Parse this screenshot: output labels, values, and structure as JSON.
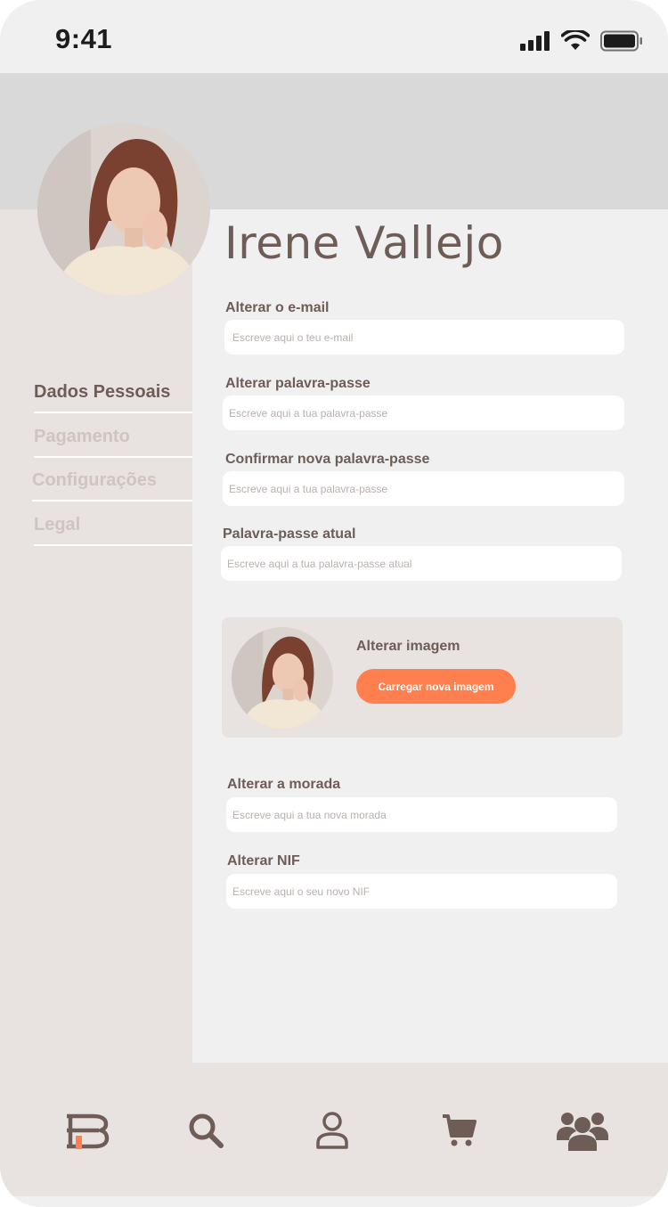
{
  "status_bar": {
    "time": "9:41"
  },
  "profile": {
    "name": "Irene Vallejo"
  },
  "sidebar": {
    "items": [
      {
        "label": "Dados Pessoais",
        "active": true
      },
      {
        "label": "Pagamento",
        "active": false
      },
      {
        "label": "Configurações",
        "active": false
      },
      {
        "label": "Legal",
        "active": false
      }
    ]
  },
  "form": {
    "email": {
      "label": "Alterar o e-mail",
      "placeholder": "Escreve aqui o teu e-mail"
    },
    "password": {
      "label": "Alterar palavra-passe",
      "placeholder": "Escreve aqui a tua palavra-passe"
    },
    "confirm_password": {
      "label": "Confirmar nova palavra-passe",
      "placeholder": "Escreve aqui a tua palavra-passe"
    },
    "current_password": {
      "label": "Palavra-passe atual",
      "placeholder": "Escreve aqui a tua palavra-passe atual"
    },
    "image": {
      "title": "Alterar imagem",
      "button": "Carregar nova imagem"
    },
    "address": {
      "label": "Alterar a morada",
      "placeholder": "Escreve aqui a tua nova morada"
    },
    "nif": {
      "label": "Alterar NIF",
      "placeholder": "Escreve aqui o seu novo NIF"
    }
  },
  "tabbar": {
    "items": [
      {
        "icon": "books-logo-icon"
      },
      {
        "icon": "search-icon"
      },
      {
        "icon": "profile-icon"
      },
      {
        "icon": "cart-icon"
      },
      {
        "icon": "community-icon"
      }
    ]
  },
  "colors": {
    "accent": "#ff7f4e",
    "text": "#6e5d56",
    "panel": "#e8e3e1",
    "background": "#f0f0f0"
  }
}
